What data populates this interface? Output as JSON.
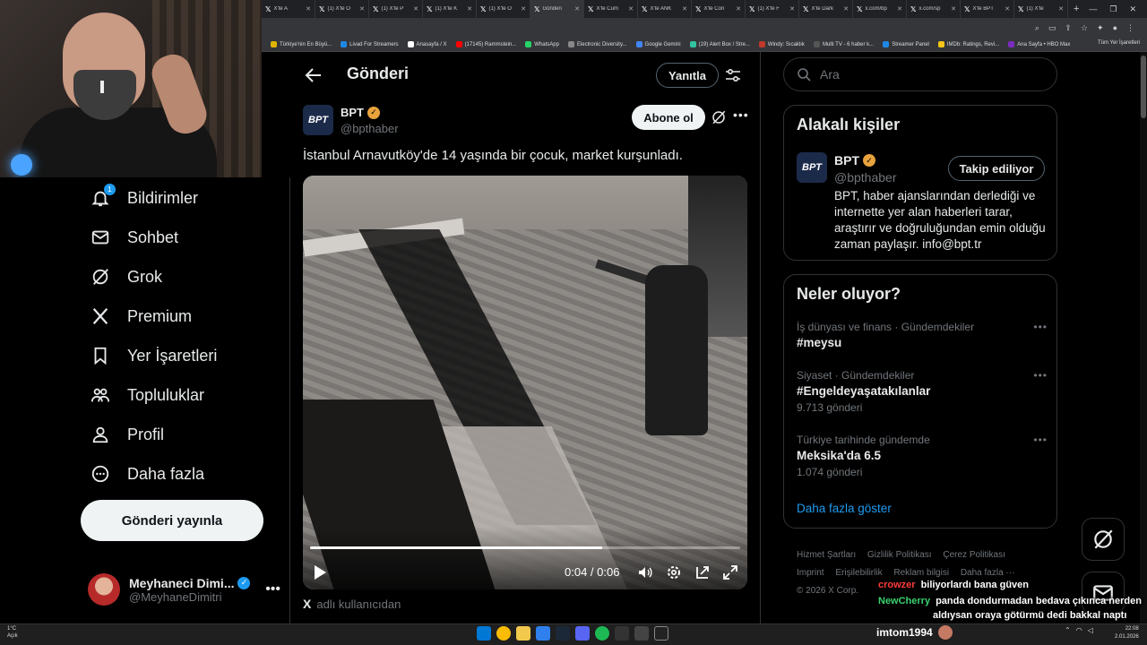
{
  "browser": {
    "tabs": [
      {
        "title": "X'te A",
        "icon": "x-icon"
      },
      {
        "title": "(1) X'te O",
        "icon": "x-icon"
      },
      {
        "title": "(1) X'te P",
        "icon": "x-icon"
      },
      {
        "title": "(1) X'te K",
        "icon": "x-icon"
      },
      {
        "title": "(1) X'te O",
        "icon": "x-icon"
      },
      {
        "title": "Gönderi",
        "icon": "x-icon"
      },
      {
        "title": "X'te Cum",
        "icon": "x-icon"
      },
      {
        "title": "X'te ANK",
        "icon": "x-icon"
      },
      {
        "title": "X'te Con",
        "icon": "x-icon"
      },
      {
        "title": "(1) X'te F",
        "icon": "x-icon"
      },
      {
        "title": "X'te Dark",
        "icon": "x-icon"
      },
      {
        "title": "x.com/bp",
        "icon": "x-icon"
      },
      {
        "title": "x.com/sp",
        "icon": "x-icon"
      },
      {
        "title": "X'te BPT",
        "icon": "x-icon"
      },
      {
        "title": "(1) X'te",
        "icon": "x-icon"
      }
    ],
    "bookmarks": [
      {
        "label": "Türkiye'nin En Büyü...",
        "color": "#e0b300"
      },
      {
        "label": "Livad For Streamers",
        "color": "#1e88e5"
      },
      {
        "label": "Anasayfa / X",
        "color": "#ffffff"
      },
      {
        "label": "(17145) Rammstein...",
        "color": "#ff0000"
      },
      {
        "label": "WhatsApp",
        "color": "#25d366"
      },
      {
        "label": "Electronic Diversity...",
        "color": "#888888"
      },
      {
        "label": "Google Gemini",
        "color": "#4285f4"
      },
      {
        "label": "(19) Alert Box / Stre...",
        "color": "#31c3a2"
      },
      {
        "label": "Windy: Sıcaklık",
        "color": "#c0392b"
      },
      {
        "label": "Multi TV - 6 haber k...",
        "color": "#555555"
      },
      {
        "label": "Streamer Panel",
        "color": "#1e88e5"
      },
      {
        "label": "IMDb: Ratings, Revi...",
        "color": "#f5c518"
      },
      {
        "label": "Ana Sayfa • HBO Max",
        "color": "#7b2cbf"
      }
    ],
    "bookmarks_right": "Tüm Yer İşaretleri"
  },
  "nav": {
    "items": [
      {
        "label": "Bildirimler",
        "icon": "bell-icon",
        "badge": "1"
      },
      {
        "label": "Sohbet",
        "icon": "mail-icon"
      },
      {
        "label": "Grok",
        "icon": "grok-icon"
      },
      {
        "label": "Premium",
        "icon": "x-logo-icon"
      },
      {
        "label": "Yer İşaretleri",
        "icon": "bookmark-icon"
      },
      {
        "label": "Topluluklar",
        "icon": "people-icon"
      },
      {
        "label": "Profil",
        "icon": "person-icon"
      },
      {
        "label": "Daha fazla",
        "icon": "more-circle-icon"
      }
    ],
    "post_button": "Gönderi yayınla",
    "account": {
      "name": "Meyhaneci Dimi...",
      "handle": "@MeyhaneDimitri"
    }
  },
  "main": {
    "title": "Gönderi",
    "reply_button": "Yanıtla",
    "post": {
      "author_avatar_text": "BPT",
      "author_name": "BPT",
      "author_handle": "@bpthaber",
      "follow_button": "Abone ol",
      "text": "İstanbul Arnavutköy'de 14 yaşında bir çocuk, market kurşunladı.",
      "video": {
        "time": "0:04 / 0:06",
        "progress": 0.68
      },
      "attribution_mark": "X",
      "attribution": "adlı kullanıcıdan"
    }
  },
  "right": {
    "search_placeholder": "Ara",
    "related": {
      "title": "Alakalı kişiler",
      "avatar_text": "BPT",
      "name": "BPT",
      "handle": "@bpthaber",
      "follow_button": "Takip ediliyor",
      "bio": "BPT, haber ajanslarından derlediği ve internette yer alan haberleri tarar, araştırır ve doğruluğundan emin olduğu zaman paylaşır. info@bpt.tr"
    },
    "trends": {
      "title": "Neler oluyor?",
      "items": [
        {
          "context": "İş dünyası ve finans · Gündemdekiler",
          "name": "#meysu",
          "count": ""
        },
        {
          "context": "Siyaset · Gündemdekiler",
          "name": "#Engeldeyaşatakılanlar",
          "count": "9.713 gönderi"
        },
        {
          "context": "Türkiye tarihinde gündemde",
          "name": "Meksika'da 6.5",
          "count": "1.074 gönderi"
        }
      ],
      "show_more": "Daha fazla göster"
    },
    "footer": {
      "links": [
        "Hizmet Şartları",
        "Gizlilik Politikası",
        "Çerez Politikası",
        "Imprint",
        "Erişilebilirlik",
        "Reklam bilgisi",
        "Daha fazla ···"
      ],
      "copyright": "© 2026 X Corp."
    }
  },
  "chat": [
    {
      "user": "crowzer",
      "user_color": "#ff3b3b",
      "message": "biliyorlardı bana güven"
    },
    {
      "user": "NewCherry",
      "user_color": "#3bd16f",
      "message": "panda dondurmadan bedava çıkınca nerden"
    },
    {
      "user": "",
      "user_color": "#ffffff",
      "message": "aldıysan oraya götürmü dedi bakkal naptı"
    }
  ],
  "streamer": "imtom1994",
  "taskbar": {
    "weather_temp": "1°C",
    "weather_desc": "Açık",
    "time": "22:08",
    "date": "2.01.2026"
  }
}
